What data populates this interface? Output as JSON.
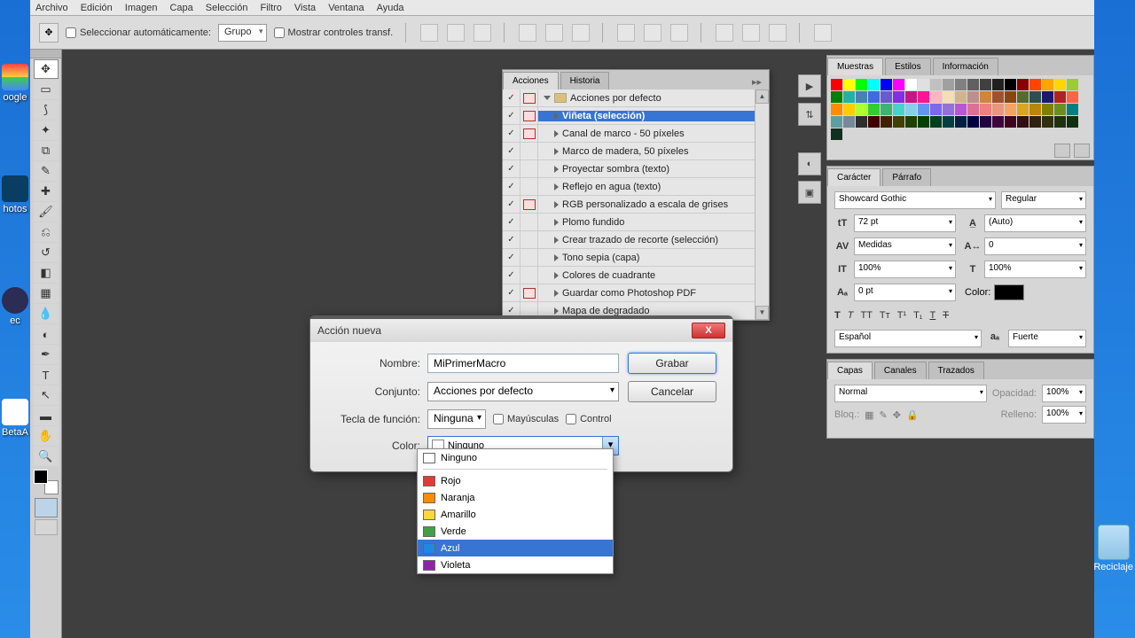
{
  "menu": [
    "Archivo",
    "Edición",
    "Imagen",
    "Capa",
    "Selección",
    "Filtro",
    "Vista",
    "Ventana",
    "Ayuda"
  ],
  "options": {
    "auto_select": "Seleccionar automáticamente:",
    "group": "Grupo",
    "show_transform": "Mostrar controles transf."
  },
  "actions_panel": {
    "tab1": "Acciones",
    "tab2": "Historia",
    "set": "Acciones por defecto",
    "items": [
      {
        "label": "Viñeta (selección)",
        "dlg": true,
        "sel": true
      },
      {
        "label": "Canal de marco - 50 píxeles",
        "dlg": true
      },
      {
        "label": "Marco de madera, 50 píxeles",
        "dlg": false
      },
      {
        "label": "Proyectar sombra (texto)",
        "dlg": false
      },
      {
        "label": "Reflejo en agua (texto)",
        "dlg": false
      },
      {
        "label": "RGB personalizado a escala de grises",
        "dlg": true
      },
      {
        "label": "Plomo fundido",
        "dlg": false
      },
      {
        "label": "Crear trazado de recorte (selección)",
        "dlg": false
      },
      {
        "label": "Tono sepia (capa)",
        "dlg": false
      },
      {
        "label": "Colores de cuadrante",
        "dlg": false
      },
      {
        "label": "Guardar como Photoshop PDF",
        "dlg": true
      },
      {
        "label": "Mapa de degradado",
        "dlg": false
      }
    ]
  },
  "dialog": {
    "title": "Acción nueva",
    "name_lbl": "Nombre:",
    "name_val": "MiPrimerMacro",
    "set_lbl": "Conjunto:",
    "set_val": "Acciones por defecto",
    "fkey_lbl": "Tecla de función:",
    "fkey_val": "Ninguna",
    "shift": "Mayúsculas",
    "ctrl": "Control",
    "color_lbl": "Color:",
    "color_val": "Ninguno",
    "record": "Grabar",
    "cancel": "Cancelar"
  },
  "colors": [
    {
      "name": "Ninguno",
      "c": "#ffffff"
    },
    {
      "name": "Rojo",
      "c": "#e53935"
    },
    {
      "name": "Naranja",
      "c": "#fb8c00"
    },
    {
      "name": "Amarillo",
      "c": "#fdd835"
    },
    {
      "name": "Verde",
      "c": "#43a047"
    },
    {
      "name": "Azul",
      "c": "#1e88e5",
      "sel": true
    },
    {
      "name": "Violeta",
      "c": "#8e24aa"
    }
  ],
  "right": {
    "swatches": "Muestras",
    "styles": "Estilos",
    "info": "Información",
    "character": "Carácter",
    "paragraph": "Párrafo",
    "font": "Showcard Gothic",
    "weight": "Regular",
    "size": "72 pt",
    "leading": "(Auto)",
    "kerning": "Medidas",
    "tracking": "0",
    "vscale": "100%",
    "hscale": "100%",
    "baseline": "0 pt",
    "color_lbl": "Color:",
    "lang": "Español",
    "aa": "Fuerte",
    "layers": "Capas",
    "channels": "Canales",
    "paths": "Trazados",
    "mode": "Normal",
    "opacity_lbl": "Opacidad:",
    "opacity": "100%",
    "lock_lbl": "Bloq.:",
    "fill_lbl": "Relleno:",
    "fill": "100%"
  },
  "swatch_colors": [
    "#ff0000",
    "#ffff00",
    "#00ff00",
    "#00ffff",
    "#0000ff",
    "#ff00ff",
    "#ffffff",
    "#e0e0e0",
    "#c0c0c0",
    "#a0a0a0",
    "#808080",
    "#606060",
    "#404040",
    "#202020",
    "#000000",
    "#8b0000",
    "#ff4500",
    "#ffa500",
    "#ffd700",
    "#9acd32",
    "#008000",
    "#20b2aa",
    "#4682b4",
    "#4169e1",
    "#6a5acd",
    "#8a2be2",
    "#c71585",
    "#ff1493",
    "#ffb6c1",
    "#f5deb3",
    "#d2b48c",
    "#bc8f8f",
    "#cd853f",
    "#a0522d",
    "#8b4513",
    "#556b2f",
    "#2f4f4f",
    "#191970",
    "#b22222",
    "#ff6347",
    "#ff8c00",
    "#ffcc00",
    "#adff2f",
    "#32cd32",
    "#3cb371",
    "#48d1cc",
    "#87ceeb",
    "#6495ed",
    "#7b68ee",
    "#9370db",
    "#ba55d3",
    "#db7093",
    "#f08080",
    "#e9967a",
    "#f4a460",
    "#daa520",
    "#b8860b",
    "#808000",
    "#6b8e23",
    "#008080",
    "#5f9ea0",
    "#778899",
    "#2e2e2e",
    "#400000",
    "#402000",
    "#404000",
    "#204000",
    "#004000",
    "#004020",
    "#004040",
    "#002040",
    "#000040",
    "#200040",
    "#400040",
    "#400020",
    "#301010",
    "#302010",
    "#303010",
    "#203010",
    "#103010",
    "#103020"
  ],
  "desk": {
    "google": "oogle",
    "photos": "hotos",
    "eclipse": "ec",
    "beta": "BetaA",
    "recycle": "Reciclaje"
  }
}
